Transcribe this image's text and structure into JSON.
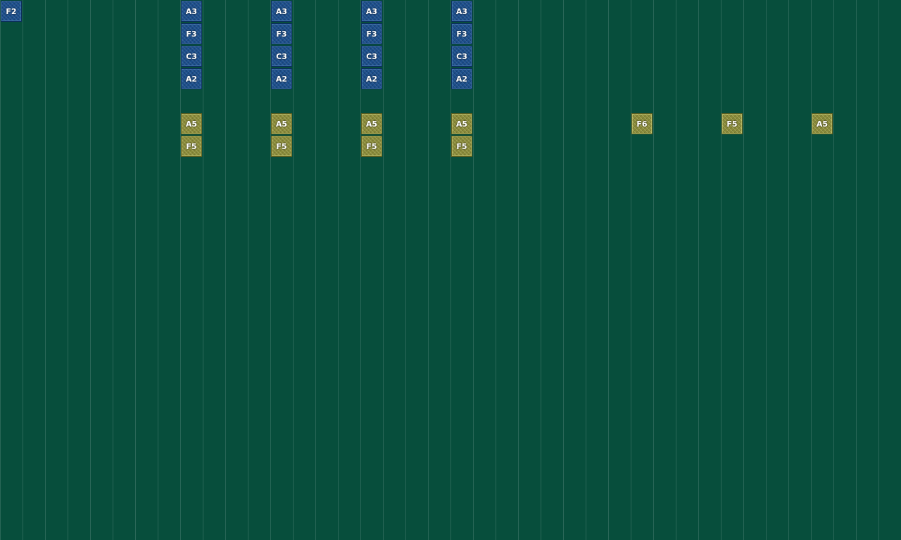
{
  "colors": {
    "background": "#074e3c",
    "grid_line": "#2a6a58",
    "blue_note": "#1c4f8c",
    "olive_note": "#8a8b3a"
  },
  "notes": [
    {
      "label": "F2",
      "color": "blue",
      "column": 0,
      "row": 0
    },
    {
      "label": "A3",
      "color": "blue",
      "column": 8,
      "row": 0
    },
    {
      "label": "F3",
      "color": "blue",
      "column": 8,
      "row": 1
    },
    {
      "label": "C3",
      "color": "blue",
      "column": 8,
      "row": 2
    },
    {
      "label": "A2",
      "color": "blue",
      "column": 8,
      "row": 3
    },
    {
      "label": "A5",
      "color": "olive",
      "column": 8,
      "row": 5
    },
    {
      "label": "F5",
      "color": "olive",
      "column": 8,
      "row": 6
    },
    {
      "label": "A3",
      "color": "blue",
      "column": 12,
      "row": 0
    },
    {
      "label": "F3",
      "color": "blue",
      "column": 12,
      "row": 1
    },
    {
      "label": "C3",
      "color": "blue",
      "column": 12,
      "row": 2
    },
    {
      "label": "A2",
      "color": "blue",
      "column": 12,
      "row": 3
    },
    {
      "label": "A5",
      "color": "olive",
      "column": 12,
      "row": 5
    },
    {
      "label": "F5",
      "color": "olive",
      "column": 12,
      "row": 6
    },
    {
      "label": "A3",
      "color": "blue",
      "column": 16,
      "row": 0
    },
    {
      "label": "F3",
      "color": "blue",
      "column": 16,
      "row": 1
    },
    {
      "label": "C3",
      "color": "blue",
      "column": 16,
      "row": 2
    },
    {
      "label": "A2",
      "color": "blue",
      "column": 16,
      "row": 3
    },
    {
      "label": "A5",
      "color": "olive",
      "column": 16,
      "row": 5
    },
    {
      "label": "F5",
      "color": "olive",
      "column": 16,
      "row": 6
    },
    {
      "label": "A3",
      "color": "blue",
      "column": 20,
      "row": 0
    },
    {
      "label": "F3",
      "color": "blue",
      "column": 20,
      "row": 1
    },
    {
      "label": "C3",
      "color": "blue",
      "column": 20,
      "row": 2
    },
    {
      "label": "A2",
      "color": "blue",
      "column": 20,
      "row": 3
    },
    {
      "label": "A5",
      "color": "olive",
      "column": 20,
      "row": 5
    },
    {
      "label": "F5",
      "color": "olive",
      "column": 20,
      "row": 6
    },
    {
      "label": "F6",
      "color": "olive",
      "column": 28,
      "row": 5
    },
    {
      "label": "F5",
      "color": "olive",
      "column": 32,
      "row": 5
    },
    {
      "label": "A5",
      "color": "olive",
      "column": 36,
      "row": 5
    }
  ]
}
